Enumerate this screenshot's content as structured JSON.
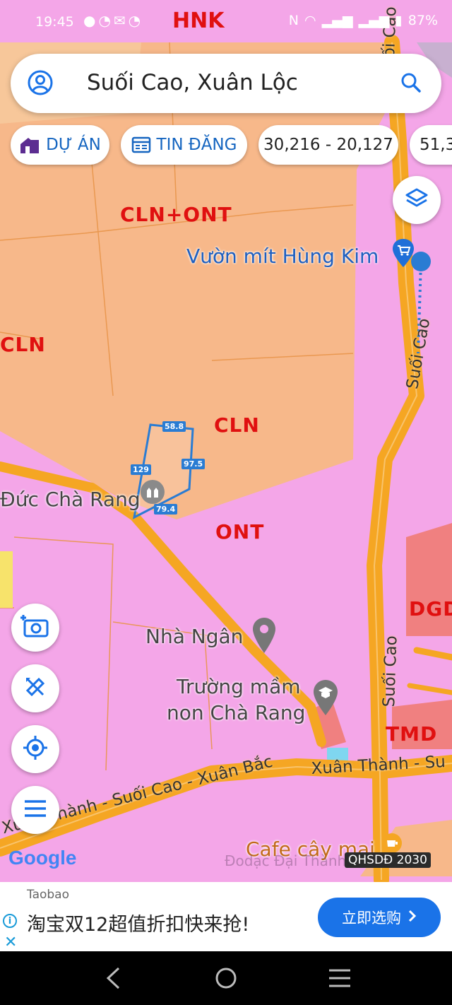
{
  "status_bar": {
    "time": "19:45",
    "carrier_text": "HNK",
    "battery": "87%"
  },
  "search": {
    "query": "Suối Cao, Xuân Lộc"
  },
  "chips": {
    "project": "DỰ ÁN",
    "listing": "TIN ĐĂNG",
    "coords": "30,216 - 20,127",
    "coords2": "51,3"
  },
  "map": {
    "zones": {
      "cln_ont": "CLN+ONT",
      "cln_left": "CLN",
      "cln_center": "CLN",
      "ont": "ONT",
      "dgd": "DGD",
      "tmd": "TMD"
    },
    "pois": {
      "vuon_mit": "Vườn mít Hùng Kim",
      "church": "Đức Chà Rang",
      "nha_ngan": "Nhà Ngân",
      "school_line1": "Trường mầm",
      "school_line2": "non Chà Rang",
      "cafe": "Cafe cây mai"
    },
    "roads": {
      "suoi_cao_top": "Suối Cao",
      "suoi_cao_mid": "Suối Cao",
      "suoi_cao_low": "Suối Cao",
      "xuan_bac": "Xuân Thành - Suối Cao - Xuân Bắc",
      "xuan_thanh_right": "Xuân Thành - Su"
    },
    "parcel_edges": {
      "top": "58.8",
      "right": "97.5",
      "bottom": "79.4",
      "left": "129"
    },
    "google_logo": "Google",
    "overlay_name": "QHSDĐ 2030",
    "watermark": "Đodạc Đại Thành"
  },
  "ad": {
    "brand": "Taobao",
    "headline": "淘宝双12超值折扣快来抢!",
    "cta": "立即选购"
  },
  "colors": {
    "residential_pink": "#f4a6e8",
    "perennial_orange": "#f7b88a",
    "road_orange": "#f5a623",
    "zone_red": "#e01010",
    "accent_blue": "#1a73e8"
  }
}
